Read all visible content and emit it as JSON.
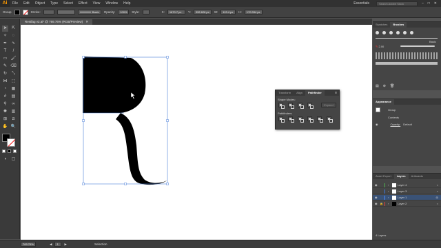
{
  "app": {
    "logo": "Ai"
  },
  "menu": [
    "File",
    "Edit",
    "Object",
    "Type",
    "Select",
    "Effect",
    "View",
    "Window",
    "Help"
  ],
  "workspace": "Essentials",
  "search_placeholder": "Search Adobe Stock",
  "control": {
    "selection_label": "Group",
    "stroke_label": "Stroke:",
    "brush_label": "Basic",
    "opacity_label": "Opacity:",
    "opacity_value": "100%",
    "style_label": "Style:",
    "x_value": "1670.7 px",
    "y_value": "392.628 px",
    "w_value": "113.4 px",
    "h_value": "170.334 px"
  },
  "document_tab": "Restfag v2.ai* @ 769.76% (RGB/Preview)",
  "pathfinder": {
    "tabs": [
      "Transform",
      "Align",
      "Pathfinder"
    ],
    "active_tab": "Pathfinder",
    "shape_modes_label": "Shape Modes:",
    "expand_label": "Expand",
    "pathfinders_label": "Pathfinders:"
  },
  "brushes_panel": {
    "tabs": [
      "Swatches",
      "Brushes"
    ],
    "active_tab": "Brushes",
    "basic_label": "Basic",
    "size_label": "2.00"
  },
  "appearance_panel": {
    "title": "Appearance",
    "group_label": "Group",
    "contents_label": "Contents",
    "opacity_label": "Opacity:",
    "opacity_value": "Default"
  },
  "layers_panel": {
    "tabs": [
      "Asset Export",
      "Layers",
      "Artboards"
    ],
    "active_tab": "Layers",
    "layers": [
      {
        "name": "Layer 4",
        "color": "#4fb34f"
      },
      {
        "name": "Layer 3",
        "color": "#3c7be0"
      },
      {
        "name": "Layer 1",
        "color": "#4a8bff"
      },
      {
        "name": "Layer 2",
        "color": "#e04040"
      }
    ],
    "count_label": "4 Layers"
  },
  "status": {
    "zoom": "769.76%",
    "page": "1",
    "tool": "Selection"
  },
  "colors": {
    "accent": "#ff9a00",
    "selection": "#4a7fd8"
  }
}
